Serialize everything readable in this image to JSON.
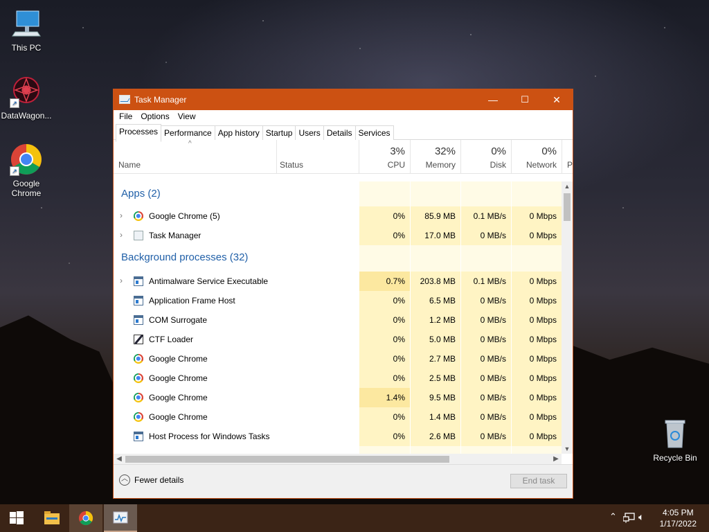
{
  "desktop": {
    "icons": [
      {
        "label": "This PC"
      },
      {
        "label": "DataWagon..."
      },
      {
        "label": "Google Chrome"
      },
      {
        "label": "Recycle Bin"
      }
    ]
  },
  "window": {
    "title": "Task Manager",
    "controls": {
      "minimize": "—",
      "maximize": "☐",
      "close": "✕"
    },
    "menu": [
      "File",
      "Options",
      "View"
    ],
    "tabs": [
      "Processes",
      "Performance",
      "App history",
      "Startup",
      "Users",
      "Details",
      "Services"
    ],
    "active_tab": "Processes",
    "columns": {
      "name": "Name",
      "status": "Status",
      "cpu": {
        "percent": "3%",
        "label": "CPU"
      },
      "memory": {
        "percent": "32%",
        "label": "Memory"
      },
      "disk": {
        "percent": "0%",
        "label": "Disk"
      },
      "network": {
        "percent": "0%",
        "label": "Network"
      },
      "power": "P"
    },
    "groups": {
      "apps": "Apps (2)",
      "background": "Background processes (32)"
    },
    "apps": [
      {
        "name": "Google Chrome (5)",
        "icon": "chrome-icon",
        "expand": true,
        "cpu": "0%",
        "memory": "85.9 MB",
        "disk": "0.1 MB/s",
        "network": "0 Mbps"
      },
      {
        "name": "Task Manager",
        "icon": "task-manager-icon",
        "expand": true,
        "cpu": "0%",
        "memory": "17.0 MB",
        "disk": "0 MB/s",
        "network": "0 Mbps"
      }
    ],
    "background": [
      {
        "name": "Antimalware Service Executable",
        "icon": "process-icon",
        "expand": true,
        "cpu": "0.7%",
        "memory": "203.8 MB",
        "disk": "0.1 MB/s",
        "network": "0 Mbps"
      },
      {
        "name": "Application Frame Host",
        "icon": "process-icon",
        "expand": false,
        "cpu": "0%",
        "memory": "6.5 MB",
        "disk": "0 MB/s",
        "network": "0 Mbps"
      },
      {
        "name": "COM Surrogate",
        "icon": "process-icon",
        "expand": false,
        "cpu": "0%",
        "memory": "1.2 MB",
        "disk": "0 MB/s",
        "network": "0 Mbps"
      },
      {
        "name": "CTF Loader",
        "icon": "ctf-icon",
        "expand": false,
        "cpu": "0%",
        "memory": "5.0 MB",
        "disk": "0 MB/s",
        "network": "0 Mbps"
      },
      {
        "name": "Google Chrome",
        "icon": "chrome-icon",
        "expand": false,
        "cpu": "0%",
        "memory": "2.7 MB",
        "disk": "0 MB/s",
        "network": "0 Mbps"
      },
      {
        "name": "Google Chrome",
        "icon": "chrome-icon",
        "expand": false,
        "cpu": "0%",
        "memory": "2.5 MB",
        "disk": "0 MB/s",
        "network": "0 Mbps"
      },
      {
        "name": "Google Chrome",
        "icon": "chrome-icon",
        "expand": false,
        "cpu": "1.4%",
        "memory": "9.5 MB",
        "disk": "0 MB/s",
        "network": "0 Mbps"
      },
      {
        "name": "Google Chrome",
        "icon": "chrome-icon",
        "expand": false,
        "cpu": "0%",
        "memory": "1.4 MB",
        "disk": "0 MB/s",
        "network": "0 Mbps"
      },
      {
        "name": "Host Process for Windows Tasks",
        "icon": "process-icon",
        "expand": false,
        "cpu": "0%",
        "memory": "2.6 MB",
        "disk": "0 MB/s",
        "network": "0 Mbps"
      }
    ],
    "footer": {
      "fewer_details": "Fewer details",
      "end_task": "End task"
    }
  },
  "taskbar": {
    "clock_time": "4:05 PM",
    "clock_date": "1/17/2022",
    "items": [
      "start-icon",
      "file-explorer-icon",
      "chrome-icon",
      "task-manager-icon"
    ]
  },
  "colors": {
    "titlebar": "#cc5112",
    "cpu_heat": "#fff4c4",
    "cpu_heat_strong": "#fce8a0",
    "group_text": "#2160a8",
    "taskbar": "#3b2416"
  }
}
